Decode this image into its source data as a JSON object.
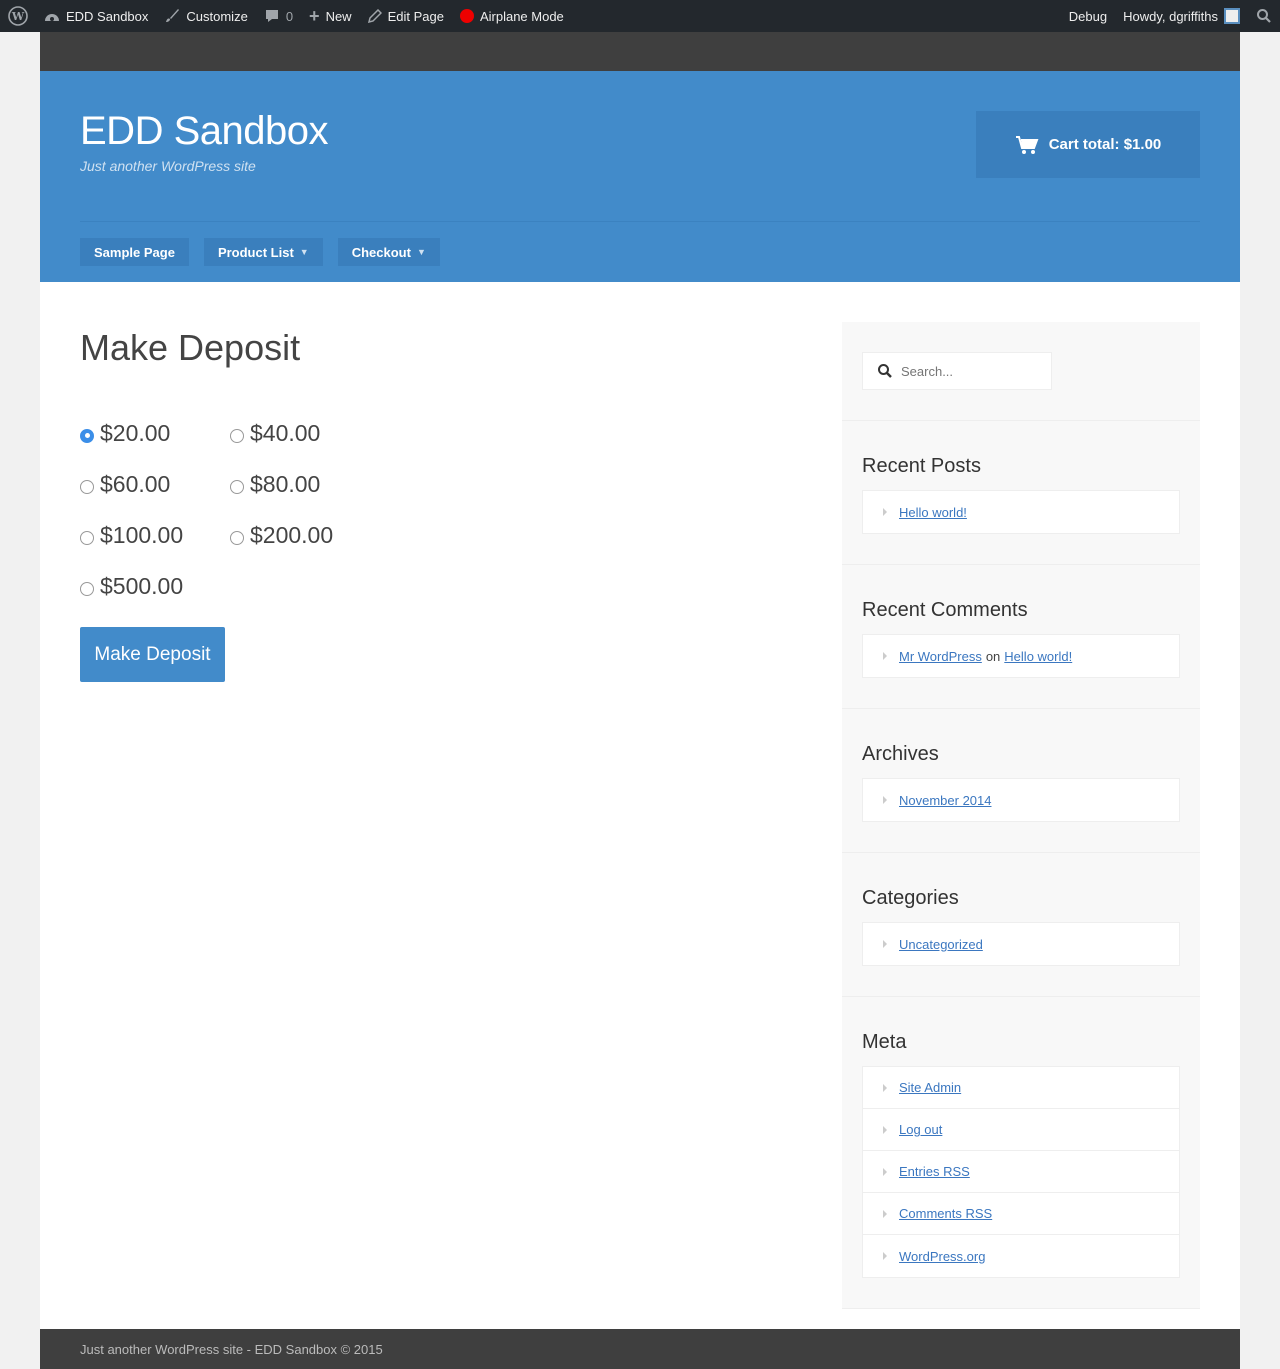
{
  "adminbar": {
    "site": "EDD Sandbox",
    "customize": "Customize",
    "comments": "0",
    "new": "New",
    "edit_page": "Edit Page",
    "airplane": "Airplane Mode",
    "debug": "Debug",
    "howdy": "Howdy, dgriffiths",
    "airplane_color": "#e00"
  },
  "header": {
    "title": "EDD Sandbox",
    "description": "Just another WordPress site",
    "cart": "Cart total: $1.00"
  },
  "nav": [
    {
      "label": "Sample Page",
      "dropdown": false
    },
    {
      "label": "Product List",
      "dropdown": true
    },
    {
      "label": "Checkout",
      "dropdown": true
    }
  ],
  "main": {
    "title": "Make Deposit",
    "amounts": [
      "$20.00",
      "$40.00",
      "$60.00",
      "$80.00",
      "$100.00",
      "$200.00",
      "$500.00"
    ],
    "selected_index": 0,
    "button": "Make Deposit"
  },
  "sidebar": {
    "search_placeholder": "Search...",
    "recent_posts": {
      "title": "Recent Posts",
      "items": [
        "Hello world!"
      ]
    },
    "recent_comments": {
      "title": "Recent Comments",
      "author": "Mr WordPress",
      "on": "on",
      "post": "Hello world!"
    },
    "archives": {
      "title": "Archives",
      "items": [
        "November 2014"
      ]
    },
    "categories": {
      "title": "Categories",
      "items": [
        "Uncategorized"
      ]
    },
    "meta": {
      "title": "Meta",
      "items": [
        "Site Admin",
        "Log out",
        "Entries RSS",
        "Comments RSS",
        "WordPress.org"
      ]
    }
  },
  "footer": {
    "text": "Just another WordPress site - EDD Sandbox © 2015"
  },
  "colors": {
    "brand": "#428bca",
    "dark": "#3f3f3f",
    "link": "#3b77c0"
  }
}
